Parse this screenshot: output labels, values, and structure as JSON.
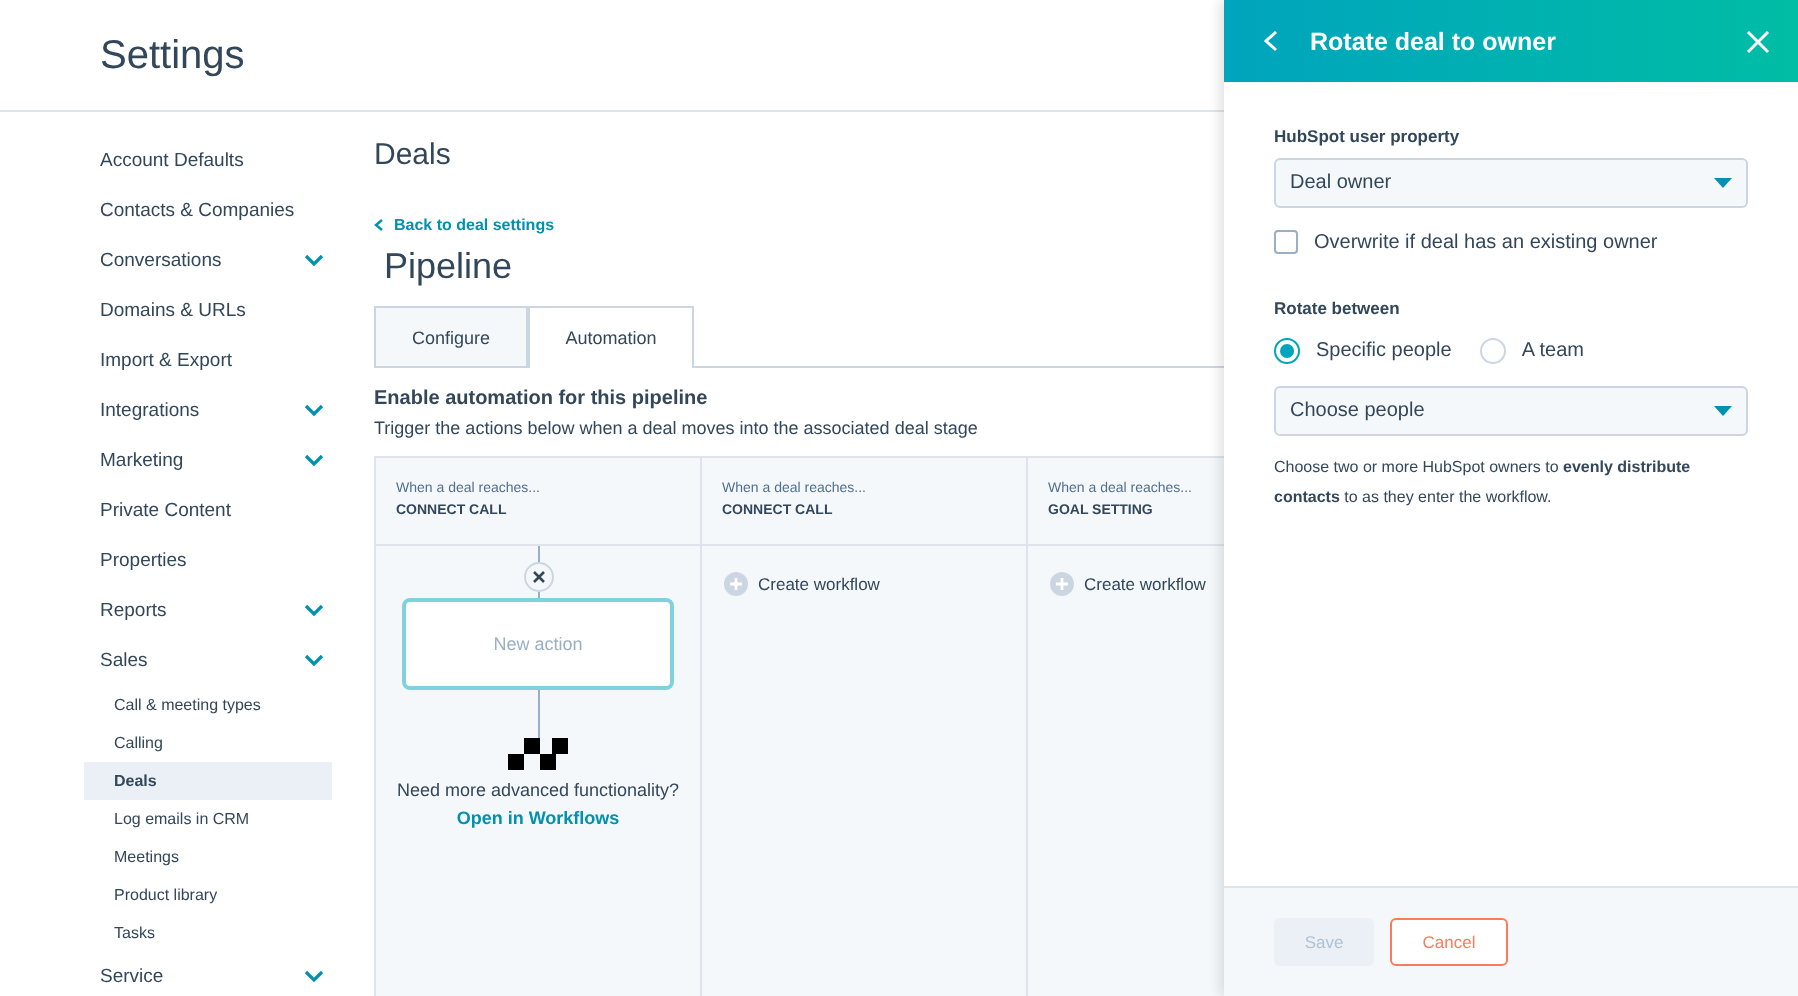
{
  "header": {
    "title": "Settings"
  },
  "sidebar": {
    "items": [
      {
        "label": "Account Defaults",
        "expandable": false,
        "selected": false
      },
      {
        "label": "Contacts & Companies",
        "expandable": false,
        "selected": false
      },
      {
        "label": "Conversations",
        "expandable": true,
        "selected": false
      },
      {
        "label": "Domains & URLs",
        "expandable": false,
        "selected": false
      },
      {
        "label": "Import & Export",
        "expandable": false,
        "selected": false
      },
      {
        "label": "Integrations",
        "expandable": true,
        "selected": false
      },
      {
        "label": "Marketing",
        "expandable": true,
        "selected": false
      },
      {
        "label": "Private Content",
        "expandable": false,
        "selected": false
      },
      {
        "label": "Properties",
        "expandable": false,
        "selected": false
      },
      {
        "label": "Reports",
        "expandable": true,
        "selected": false
      },
      {
        "label": "Sales",
        "expandable": true,
        "selected": false,
        "children": [
          {
            "label": "Call & meeting types",
            "selected": false
          },
          {
            "label": "Calling",
            "selected": false
          },
          {
            "label": "Deals",
            "selected": true
          },
          {
            "label": "Log emails in CRM",
            "selected": false
          },
          {
            "label": "Meetings",
            "selected": false
          },
          {
            "label": "Product library",
            "selected": false
          },
          {
            "label": "Tasks",
            "selected": false
          }
        ]
      },
      {
        "label": "Service",
        "expandable": true,
        "selected": false
      }
    ]
  },
  "main": {
    "title": "Deals",
    "back_link": "Back to deal settings",
    "heading": "Pipeline",
    "tabs": [
      {
        "label": "Configure",
        "selected": false
      },
      {
        "label": "Automation",
        "selected": true
      }
    ],
    "section_title": "Enable automation for this pipeline",
    "section_text": "Trigger the actions below when a deal moves into the associated deal stage",
    "stages": [
      {
        "kind": "action",
        "caption": "When a deal reaches...",
        "stage": "CONNECT CALL",
        "action": "New action",
        "prompt": "Need more advanced functionality?",
        "link": "Open in Workflows"
      },
      {
        "kind": "empty",
        "caption": "When a deal reaches...",
        "stage": "CONNECT CALL",
        "button": "Create workflow"
      },
      {
        "kind": "empty",
        "caption": "When a deal reaches...",
        "stage": "GOAL SETTING",
        "button": "Create workflow"
      }
    ]
  },
  "panel": {
    "title": "Rotate deal to owner",
    "property_label": "HubSpot user property",
    "property_value": "Deal owner",
    "checkbox": {
      "label": "Overwrite if deal has an existing owner",
      "checked": false
    },
    "rotate_label": "Rotate between",
    "radios": [
      {
        "label": "Specific people",
        "selected": true
      },
      {
        "label": "A team",
        "selected": false
      }
    ],
    "people_placeholder": "Choose people",
    "help": "Choose two or more HubSpot owners to **evenly distribute contacts** to as they enter the workflow.",
    "buttons": [
      {
        "kind": "primary",
        "label": "Save",
        "disabled": true
      },
      {
        "kind": "secondary",
        "label": "Cancel",
        "disabled": false
      }
    ]
  }
}
